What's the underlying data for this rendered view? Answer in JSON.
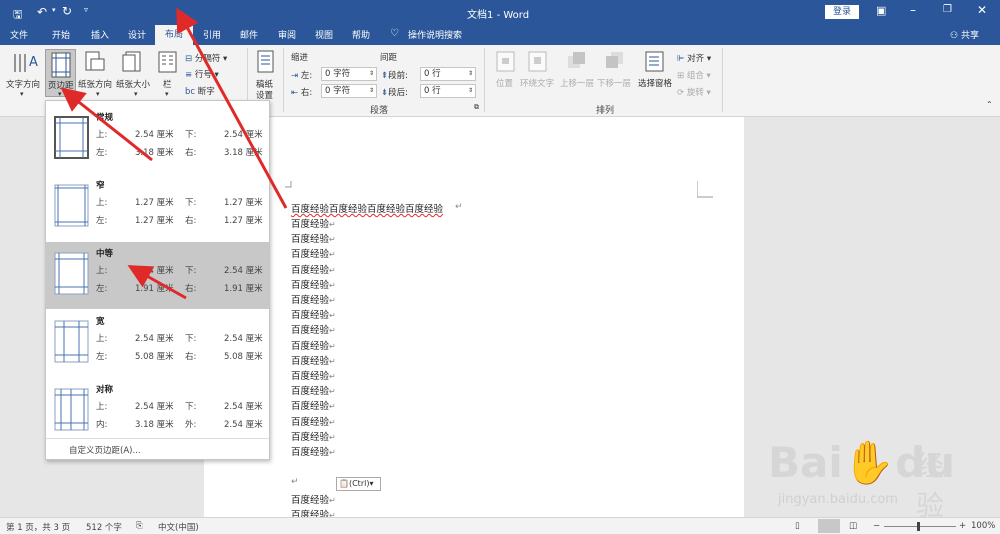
{
  "title": {
    "doc": "文档1",
    "sep": "-",
    "app": "Word",
    "login": "登录"
  },
  "tabs": {
    "file": "文件",
    "home": "开始",
    "insert": "插入",
    "design": "设计",
    "layout": "布局",
    "references": "引用",
    "mailings": "邮件",
    "review": "审阅",
    "view": "视图",
    "help": "帮助",
    "tellme": "操作说明搜索",
    "share": "共享"
  },
  "ribbon": {
    "text_direction": "文字方向",
    "margins": "页边距",
    "orientation": "纸张方向",
    "size": "纸张大小",
    "columns": "栏",
    "breaks": "分隔符",
    "line_numbers": "行号",
    "hyphenation": "断字",
    "manuscript": "稿纸",
    "manuscript2": "设置",
    "indent": "缩进",
    "spacing": "间距",
    "left": "左:",
    "right": "右:",
    "before": "段前:",
    "after": "段后:",
    "left_val": "0 字符",
    "right_val": "0 字符",
    "before_val": "0 行",
    "after_val": "0 行",
    "paragraph": "段落",
    "position": "位置",
    "wrap": "环绕文字",
    "forward": "上移一层",
    "backward": "下移一层",
    "selection_pane": "选择窗格",
    "align": "对齐",
    "group": "组合",
    "rotate": "旋转",
    "arrange": "排列"
  },
  "margins_menu": {
    "presets": [
      {
        "name": "常规",
        "r1a": "上:",
        "v1a": "2.54 厘米",
        "r1b": "下:",
        "v1b": "2.54 厘米",
        "r2a": "左:",
        "v2a": "3.18 厘米",
        "r2b": "右:",
        "v2b": "3.18 厘米"
      },
      {
        "name": "窄",
        "r1a": "上:",
        "v1a": "1.27 厘米",
        "r1b": "下:",
        "v1b": "1.27 厘米",
        "r2a": "左:",
        "v2a": "1.27 厘米",
        "r2b": "右:",
        "v2b": "1.27 厘米"
      },
      {
        "name": "中等",
        "r1a": "上:",
        "v1a": "2.54 厘米",
        "r1b": "下:",
        "v1b": "2.54 厘米",
        "r2a": "左:",
        "v2a": "1.91 厘米",
        "r2b": "右:",
        "v2b": "1.91 厘米"
      },
      {
        "name": "宽",
        "r1a": "上:",
        "v1a": "2.54 厘米",
        "r1b": "下:",
        "v1b": "2.54 厘米",
        "r2a": "左:",
        "v2a": "5.08 厘米",
        "r2b": "右:",
        "v2b": "5.08 厘米"
      },
      {
        "name": "对称",
        "r1a": "上:",
        "v1a": "2.54 厘米",
        "r1b": "下:",
        "v1b": "2.54 厘米",
        "r2a": "内:",
        "v2a": "3.18 厘米",
        "r2b": "外:",
        "v2b": "2.54 厘米"
      }
    ],
    "custom": "自定义页边距(A)..."
  },
  "document": {
    "first_line": "百度经验百度经验百度经验百度经验",
    "line": "百度经验",
    "paste_options": "(Ctrl)"
  },
  "status": {
    "page": "第 1 页，共 3 页",
    "words": "512 个字",
    "lang": "中文(中国)",
    "zoom": "100%"
  },
  "watermark": {
    "brand": "Bai",
    "du": "du",
    "cn": "经验",
    "url": "jingyan.baidu.com"
  }
}
